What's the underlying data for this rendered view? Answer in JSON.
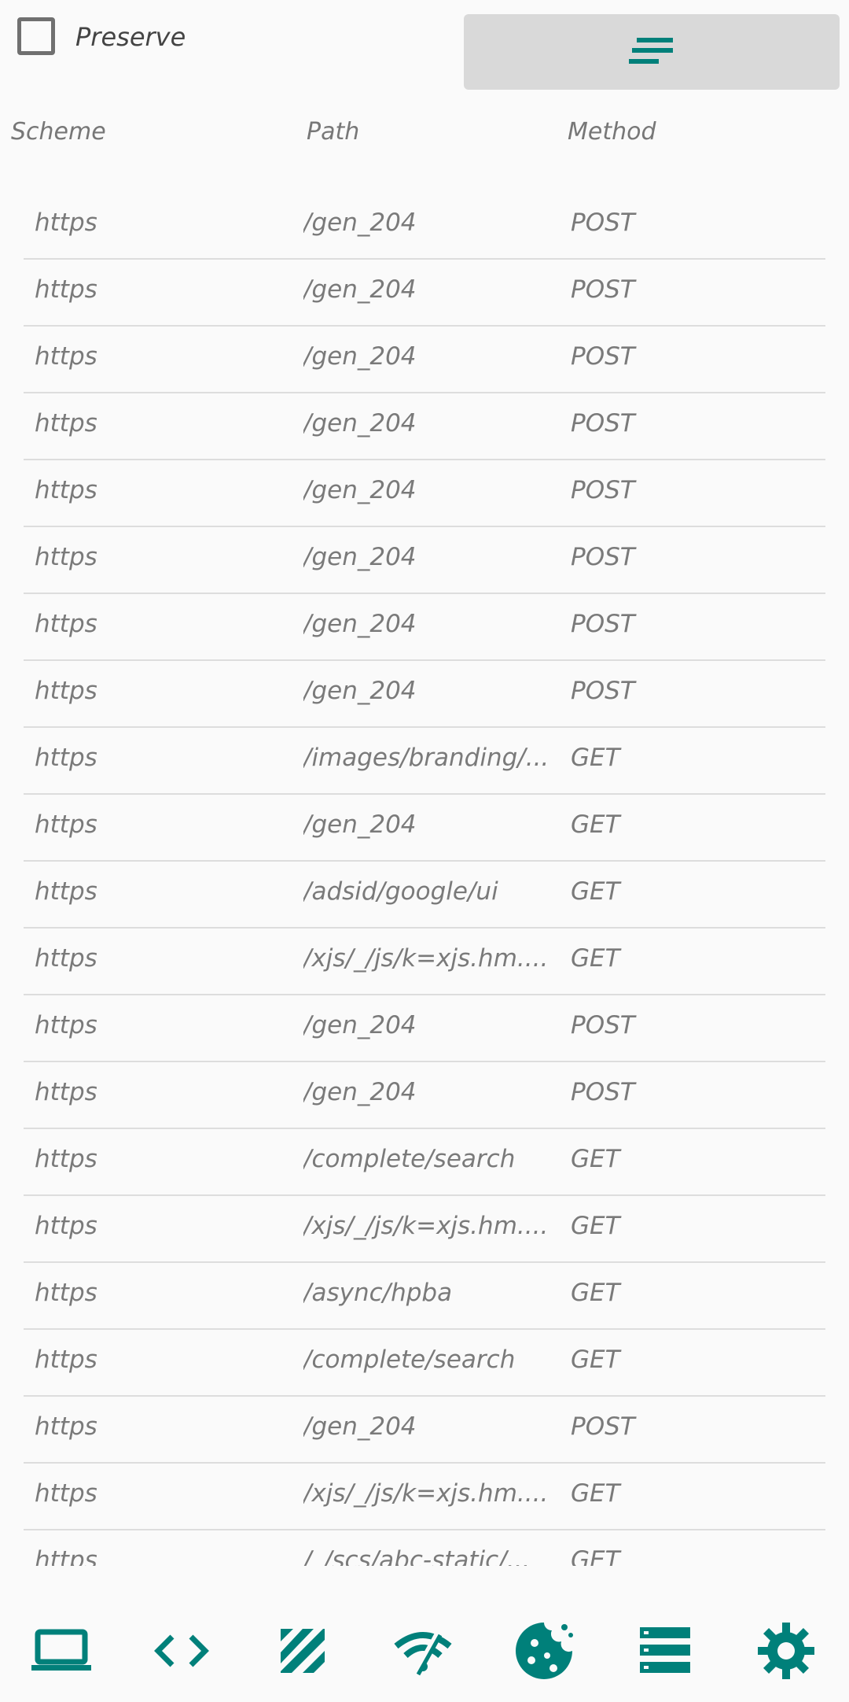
{
  "toolbar": {
    "preserve_label": "Preserve",
    "preserve_checked": false,
    "filter_icon": "sort-lines-icon"
  },
  "table": {
    "columns": [
      "Scheme",
      "Path",
      "Method"
    ],
    "rows": [
      {
        "scheme": "https",
        "path": "/gen_204",
        "method": "POST"
      },
      {
        "scheme": "https",
        "path": "/gen_204",
        "method": "POST"
      },
      {
        "scheme": "https",
        "path": "/gen_204",
        "method": "POST"
      },
      {
        "scheme": "https",
        "path": "/gen_204",
        "method": "POST"
      },
      {
        "scheme": "https",
        "path": "/gen_204",
        "method": "POST"
      },
      {
        "scheme": "https",
        "path": "/gen_204",
        "method": "POST"
      },
      {
        "scheme": "https",
        "path": "/gen_204",
        "method": "POST"
      },
      {
        "scheme": "https",
        "path": "/gen_204",
        "method": "POST"
      },
      {
        "scheme": "https",
        "path": "/images/branding/...",
        "method": "GET"
      },
      {
        "scheme": "https",
        "path": "/gen_204",
        "method": "GET"
      },
      {
        "scheme": "https",
        "path": "/adsid/google/ui",
        "method": "GET"
      },
      {
        "scheme": "https",
        "path": "/xjs/_/js/k=xjs.hm....",
        "method": "GET"
      },
      {
        "scheme": "https",
        "path": "/gen_204",
        "method": "POST"
      },
      {
        "scheme": "https",
        "path": "/gen_204",
        "method": "POST"
      },
      {
        "scheme": "https",
        "path": "/complete/search",
        "method": "GET"
      },
      {
        "scheme": "https",
        "path": "/xjs/_/js/k=xjs.hm....",
        "method": "GET"
      },
      {
        "scheme": "https",
        "path": "/async/hpba",
        "method": "GET"
      },
      {
        "scheme": "https",
        "path": "/complete/search",
        "method": "GET"
      },
      {
        "scheme": "https",
        "path": "/gen_204",
        "method": "POST"
      },
      {
        "scheme": "https",
        "path": "/xjs/_/js/k=xjs.hm....",
        "method": "GET"
      },
      {
        "scheme": "https",
        "path": "/_/scs/abc-static/...",
        "method": "GET"
      }
    ]
  },
  "bottom_nav": {
    "items": [
      {
        "icon": "laptop-icon"
      },
      {
        "icon": "code-brackets-icon"
      },
      {
        "icon": "diagonal-stripes-icon"
      },
      {
        "icon": "wifi-off-icon"
      },
      {
        "icon": "cookie-icon"
      },
      {
        "icon": "storage-list-icon"
      },
      {
        "icon": "gear-icon"
      }
    ]
  },
  "colors": {
    "accent": "#00807a",
    "text": "#777777",
    "divider": "#dddddd",
    "button_bg": "#d9d9d9"
  }
}
